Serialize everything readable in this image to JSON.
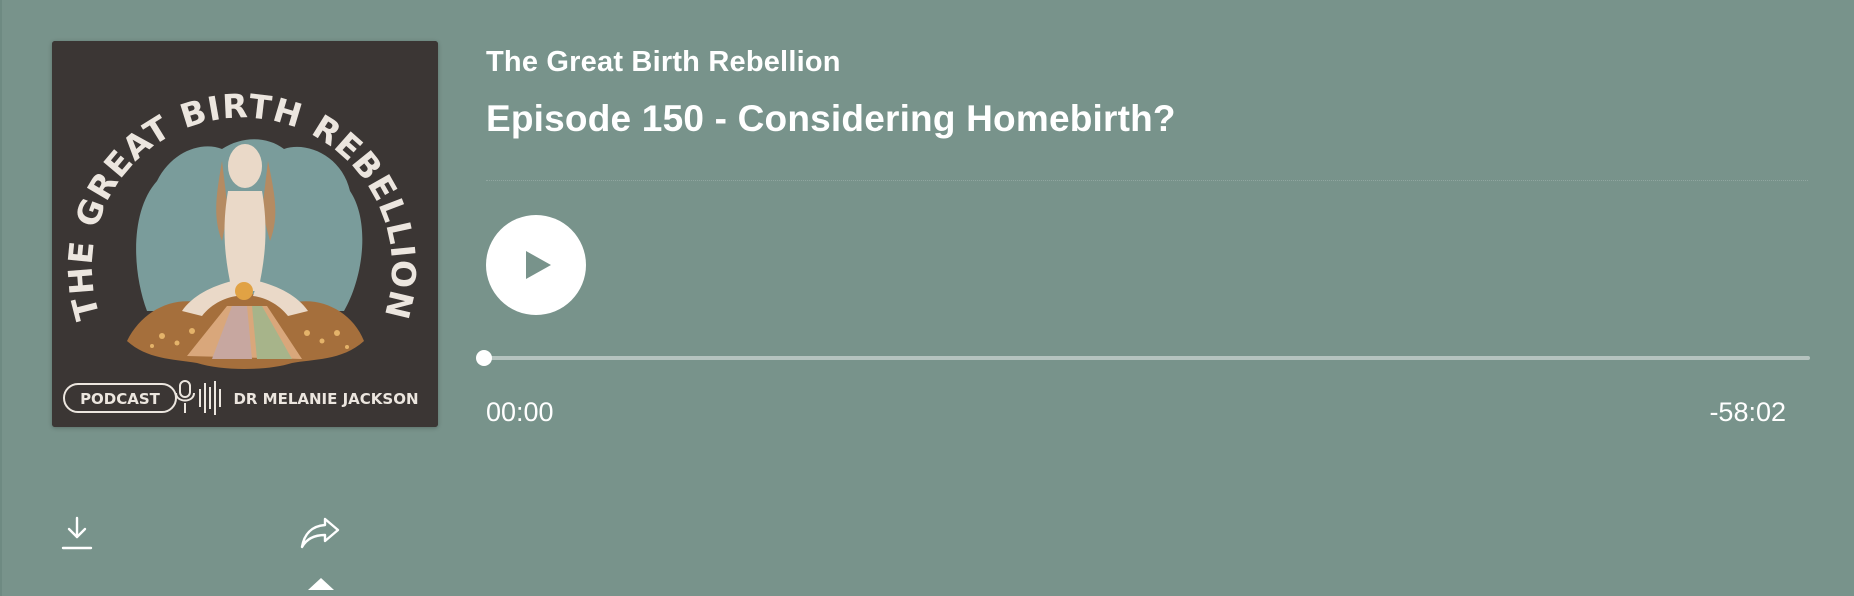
{
  "show": {
    "title": "The Great Birth Rebellion",
    "artwork": {
      "arc_text": "THE GREAT BIRTH REBELLION",
      "badge_text": "PODCAST",
      "author_text": "DR MELANIE JACKSON"
    }
  },
  "episode": {
    "title": "Episode 150 - Considering Homebirth?"
  },
  "player": {
    "elapsed": "00:00",
    "remaining": "-58:02",
    "progress_fraction": 0
  },
  "actions": {
    "download_icon": "download-icon",
    "share_icon": "share-icon"
  },
  "colors": {
    "background": "#78938b",
    "artwork_bg": "#3b3634",
    "foreground": "#ffffff"
  }
}
